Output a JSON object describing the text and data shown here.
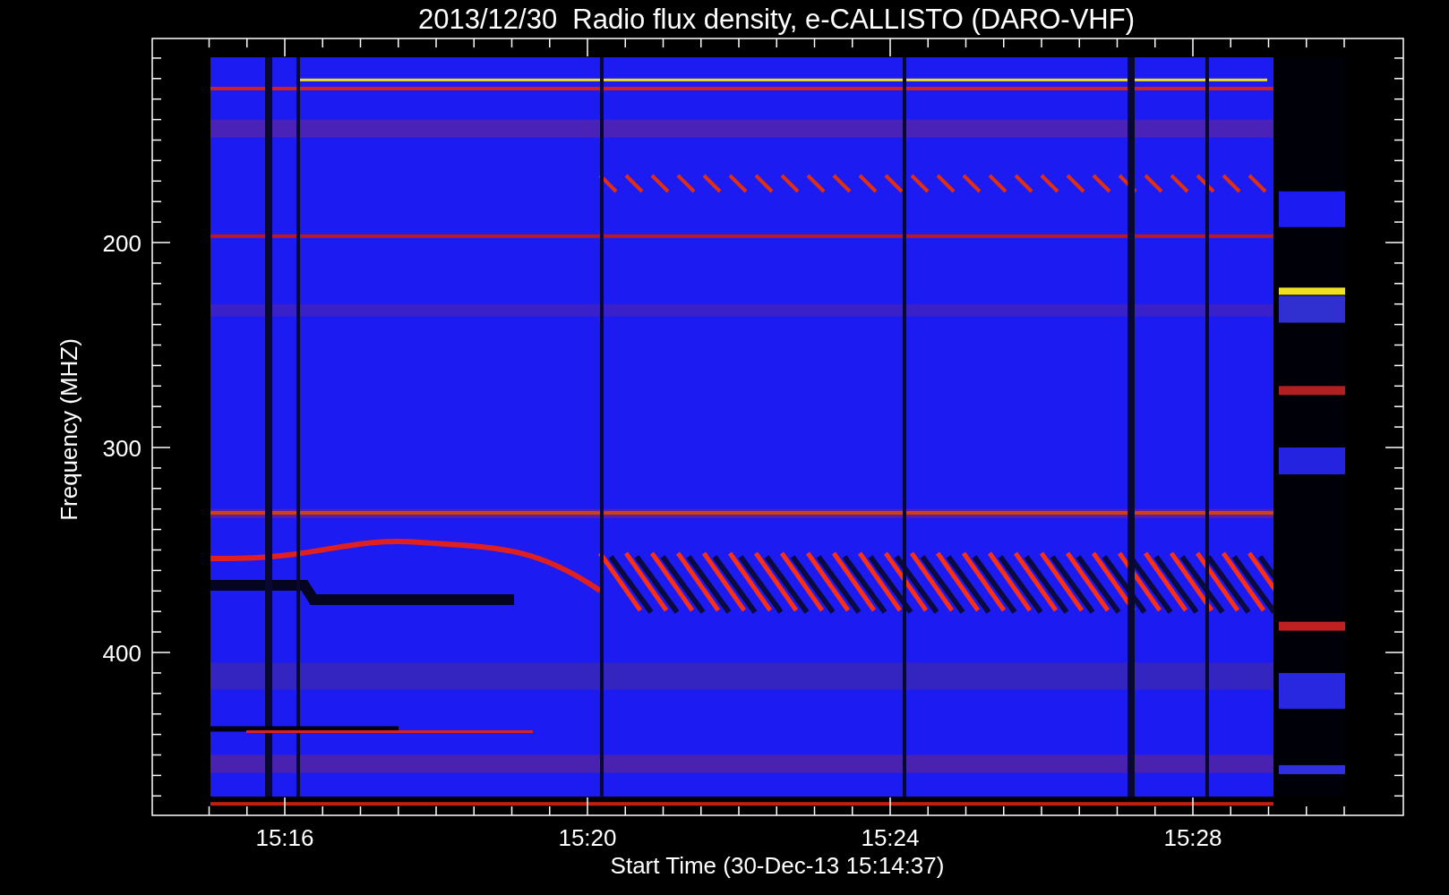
{
  "title": "2013/12/30  Radio flux density, e-CALLISTO (DARO-VHF)",
  "y_axis": {
    "label": "Frequency (MHZ)",
    "ticks": [
      "200",
      "300",
      "400"
    ]
  },
  "x_axis": {
    "label": "Start Time (30-Dec-13 15:14:37)",
    "ticks": [
      "15:16",
      "15:20",
      "15:24",
      "15:28"
    ]
  }
}
